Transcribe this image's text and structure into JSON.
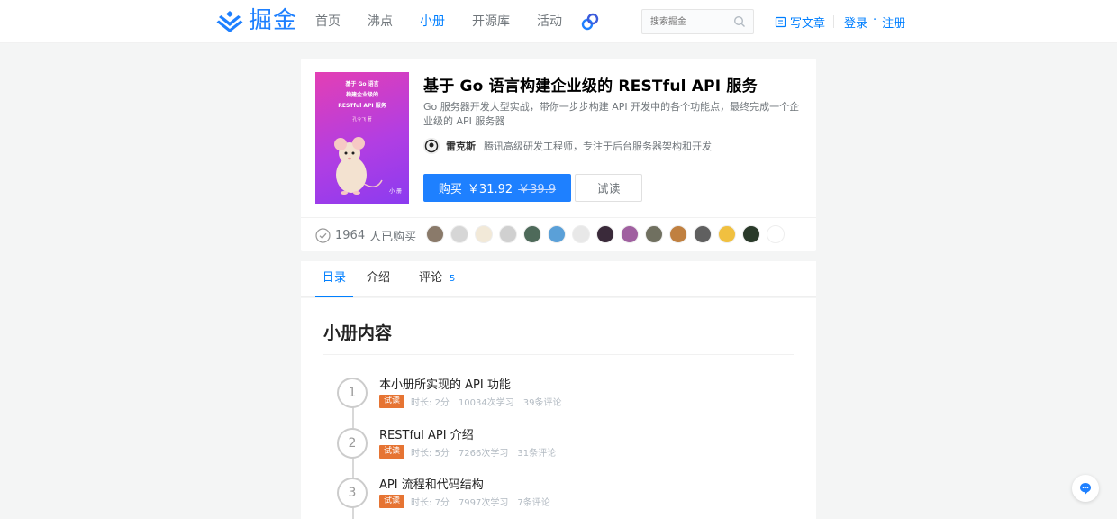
{
  "header": {
    "logo_text": "掘金",
    "nav": [
      {
        "label": "首页",
        "active": false
      },
      {
        "label": "沸点",
        "active": false
      },
      {
        "label": "小册",
        "active": true
      },
      {
        "label": "开源库",
        "active": false
      },
      {
        "label": "活动",
        "active": false
      }
    ],
    "search_placeholder": "搜索掘金",
    "write_label": "写文章",
    "login_label": "登录",
    "register_label": "注册",
    "auth_sep": "·"
  },
  "book": {
    "title": "基于 Go 语言构建企业级的 RESTful API 服务",
    "description": "Go 服务器开发大型实战，带你一步步构建 API 开发中的各个功能点，最终完成一个企业级的 API 服务器",
    "cover": {
      "title_lines": [
        "基于 Go 语言",
        "构建企业级的",
        "RESTful API 服务"
      ],
      "author": "孔令飞 著",
      "brand": "小 册"
    },
    "author": {
      "name": "雷克斯",
      "bio": "腾讯高级研发工程师，专注于后台服务器架构和开发"
    },
    "buy_label": "购买",
    "price": "￥31.92",
    "original_price": "￥39.9",
    "trial_label": "试读",
    "purchase_count": "1964",
    "purchase_suffix": "人已购买"
  },
  "buyers": [
    {
      "color": "#8a7a6a"
    },
    {
      "color": "#d6d6d6"
    },
    {
      "color": "#f2e9d8"
    },
    {
      "color": "#d0d0d0"
    },
    {
      "color": "#4e6a5a"
    },
    {
      "color": "#5aa0d8"
    },
    {
      "color": "#e8e8e8"
    },
    {
      "color": "#3a2a3a"
    },
    {
      "color": "#a060a0"
    },
    {
      "color": "#707060"
    },
    {
      "color": "#c08040"
    },
    {
      "color": "#606060"
    },
    {
      "color": "#f0c040"
    },
    {
      "color": "#2a3a2a"
    },
    {
      "color": "#ffffff"
    }
  ],
  "tabs": [
    {
      "label": "目录",
      "active": true
    },
    {
      "label": "介绍",
      "active": false
    },
    {
      "label": "评论",
      "active": false,
      "count": "5"
    }
  ],
  "content": {
    "heading": "小册内容",
    "chapters": [
      {
        "num": "1",
        "title": "本小册所实现的 API 功能",
        "badge": "试读",
        "duration": "时长: 2分",
        "reads": "10034次学习",
        "comments": "39条评论"
      },
      {
        "num": "2",
        "title": "RESTful API 介绍",
        "badge": "试读",
        "duration": "时长: 5分",
        "reads": "7266次学习",
        "comments": "31条评论"
      },
      {
        "num": "3",
        "title": "API 流程和代码结构",
        "badge": "试读",
        "duration": "时长: 7分",
        "reads": "7997次学习",
        "comments": "7条评论"
      }
    ]
  },
  "colors": {
    "accent": "#007fff",
    "buy_button": "#1e80ff",
    "trial_badge": "#e67433"
  }
}
